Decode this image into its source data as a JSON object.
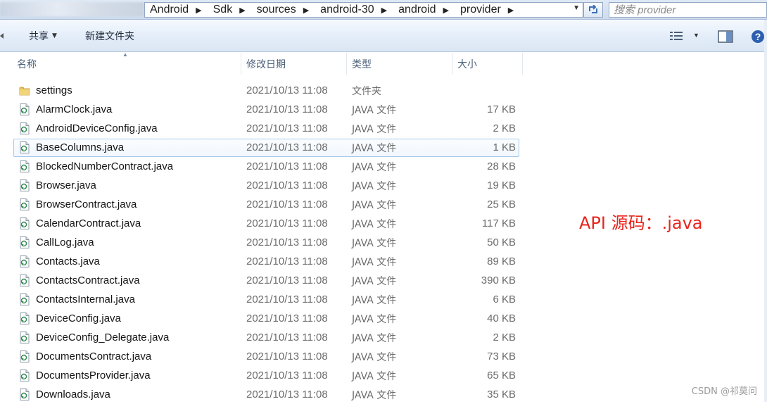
{
  "address": {
    "crumbs": [
      "Android",
      "Sdk",
      "sources",
      "android-30",
      "android",
      "provider"
    ],
    "search_placeholder": "搜索 provider"
  },
  "toolbar": {
    "share_label": "共享",
    "new_folder_label": "新建文件夹"
  },
  "columns": {
    "name": "名称",
    "date": "修改日期",
    "type": "类型",
    "size": "大小"
  },
  "files": [
    {
      "name": "settings",
      "date": "2021/10/13 11:08",
      "type": "文件夹",
      "size": "",
      "kind": "folder-icon"
    },
    {
      "name": "AlarmClock.java",
      "date": "2021/10/13 11:08",
      "type": "JAVA 文件",
      "size": "17 KB",
      "kind": "java-file-icon"
    },
    {
      "name": "AndroidDeviceConfig.java",
      "date": "2021/10/13 11:08",
      "type": "JAVA 文件",
      "size": "2 KB",
      "kind": "java-file-icon"
    },
    {
      "name": "BaseColumns.java",
      "date": "2021/10/13 11:08",
      "type": "JAVA 文件",
      "size": "1 KB",
      "kind": "java-file-icon",
      "selected": true
    },
    {
      "name": "BlockedNumberContract.java",
      "date": "2021/10/13 11:08",
      "type": "JAVA 文件",
      "size": "28 KB",
      "kind": "java-file-icon"
    },
    {
      "name": "Browser.java",
      "date": "2021/10/13 11:08",
      "type": "JAVA 文件",
      "size": "19 KB",
      "kind": "java-file-icon"
    },
    {
      "name": "BrowserContract.java",
      "date": "2021/10/13 11:08",
      "type": "JAVA 文件",
      "size": "25 KB",
      "kind": "java-file-icon"
    },
    {
      "name": "CalendarContract.java",
      "date": "2021/10/13 11:08",
      "type": "JAVA 文件",
      "size": "117 KB",
      "kind": "java-file-icon"
    },
    {
      "name": "CallLog.java",
      "date": "2021/10/13 11:08",
      "type": "JAVA 文件",
      "size": "50 KB",
      "kind": "java-file-icon"
    },
    {
      "name": "Contacts.java",
      "date": "2021/10/13 11:08",
      "type": "JAVA 文件",
      "size": "89 KB",
      "kind": "java-file-icon"
    },
    {
      "name": "ContactsContract.java",
      "date": "2021/10/13 11:08",
      "type": "JAVA 文件",
      "size": "390 KB",
      "kind": "java-file-icon"
    },
    {
      "name": "ContactsInternal.java",
      "date": "2021/10/13 11:08",
      "type": "JAVA 文件",
      "size": "6 KB",
      "kind": "java-file-icon"
    },
    {
      "name": "DeviceConfig.java",
      "date": "2021/10/13 11:08",
      "type": "JAVA 文件",
      "size": "40 KB",
      "kind": "java-file-icon"
    },
    {
      "name": "DeviceConfig_Delegate.java",
      "date": "2021/10/13 11:08",
      "type": "JAVA 文件",
      "size": "2 KB",
      "kind": "java-file-icon"
    },
    {
      "name": "DocumentsContract.java",
      "date": "2021/10/13 11:08",
      "type": "JAVA 文件",
      "size": "73 KB",
      "kind": "java-file-icon"
    },
    {
      "name": "DocumentsProvider.java",
      "date": "2021/10/13 11:08",
      "type": "JAVA 文件",
      "size": "65 KB",
      "kind": "java-file-icon"
    },
    {
      "name": "Downloads.java",
      "date": "2021/10/13 11:08",
      "type": "JAVA 文件",
      "size": "35 KB",
      "kind": "java-file-icon"
    }
  ],
  "annotation": "API 源码：.java",
  "watermark": "CSDN @祁莫问",
  "colors": {
    "annotation": "#e8241d",
    "folder": "#e9c35a",
    "selection_border": "#a6c8e8"
  }
}
